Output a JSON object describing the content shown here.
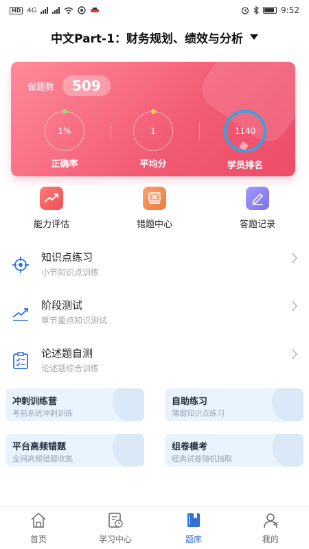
{
  "status_bar": {
    "network_badge": "HD",
    "network_type": "4G",
    "time": "9:52"
  },
  "header": {
    "title": "中文Part-1：财务规划、绩效与分析"
  },
  "stats": {
    "count_label": "做题数",
    "count_value": "509",
    "metrics": [
      {
        "value": "1%",
        "label": "正确率",
        "dot_color": "#8be36a"
      },
      {
        "value": "1",
        "label": "平均分",
        "dot_color": "#ffd64a"
      },
      {
        "value": "1140",
        "label": "学员排名",
        "ring_color": "#2fa6e0"
      }
    ]
  },
  "quick_actions": [
    {
      "label": "能力评估",
      "icon": "chart-icon",
      "color": "#f0625e"
    },
    {
      "label": "错题中心",
      "icon": "wrong-questions-icon",
      "color": "#f28a53"
    },
    {
      "label": "答题记录",
      "icon": "pen-icon",
      "color": "#8a7ff0"
    }
  ],
  "practice_list": [
    {
      "title": "知识点练习",
      "subtitle": "小节知识点训练",
      "icon": "target-icon"
    },
    {
      "title": "阶段测试",
      "subtitle": "章节重点知识测试",
      "icon": "trend-icon"
    },
    {
      "title": "论述题自测",
      "subtitle": "论述题综合训练",
      "icon": "checklist-icon"
    }
  ],
  "feature_cards": [
    {
      "title": "冲刺训练营",
      "subtitle": "考前系统冲刺训练"
    },
    {
      "title": "自助练习",
      "subtitle": "薄弱知识点练习"
    },
    {
      "title": "平台高频错题",
      "subtitle": "全网高频错题收集"
    },
    {
      "title": "组卷模考",
      "subtitle": "经典试卷随机抽取"
    }
  ],
  "bottom_nav": {
    "active": "题库",
    "items": [
      {
        "label": "首页",
        "icon": "home-icon"
      },
      {
        "label": "学习中心",
        "icon": "study-center-icon"
      },
      {
        "label": "题库",
        "icon": "question-bank-icon"
      },
      {
        "label": "我的",
        "icon": "profile-icon"
      }
    ]
  },
  "colors": {
    "accent": "#2f6fd6",
    "card_gradient_start": "#ff8a9a",
    "card_gradient_end": "#ec4d69"
  }
}
